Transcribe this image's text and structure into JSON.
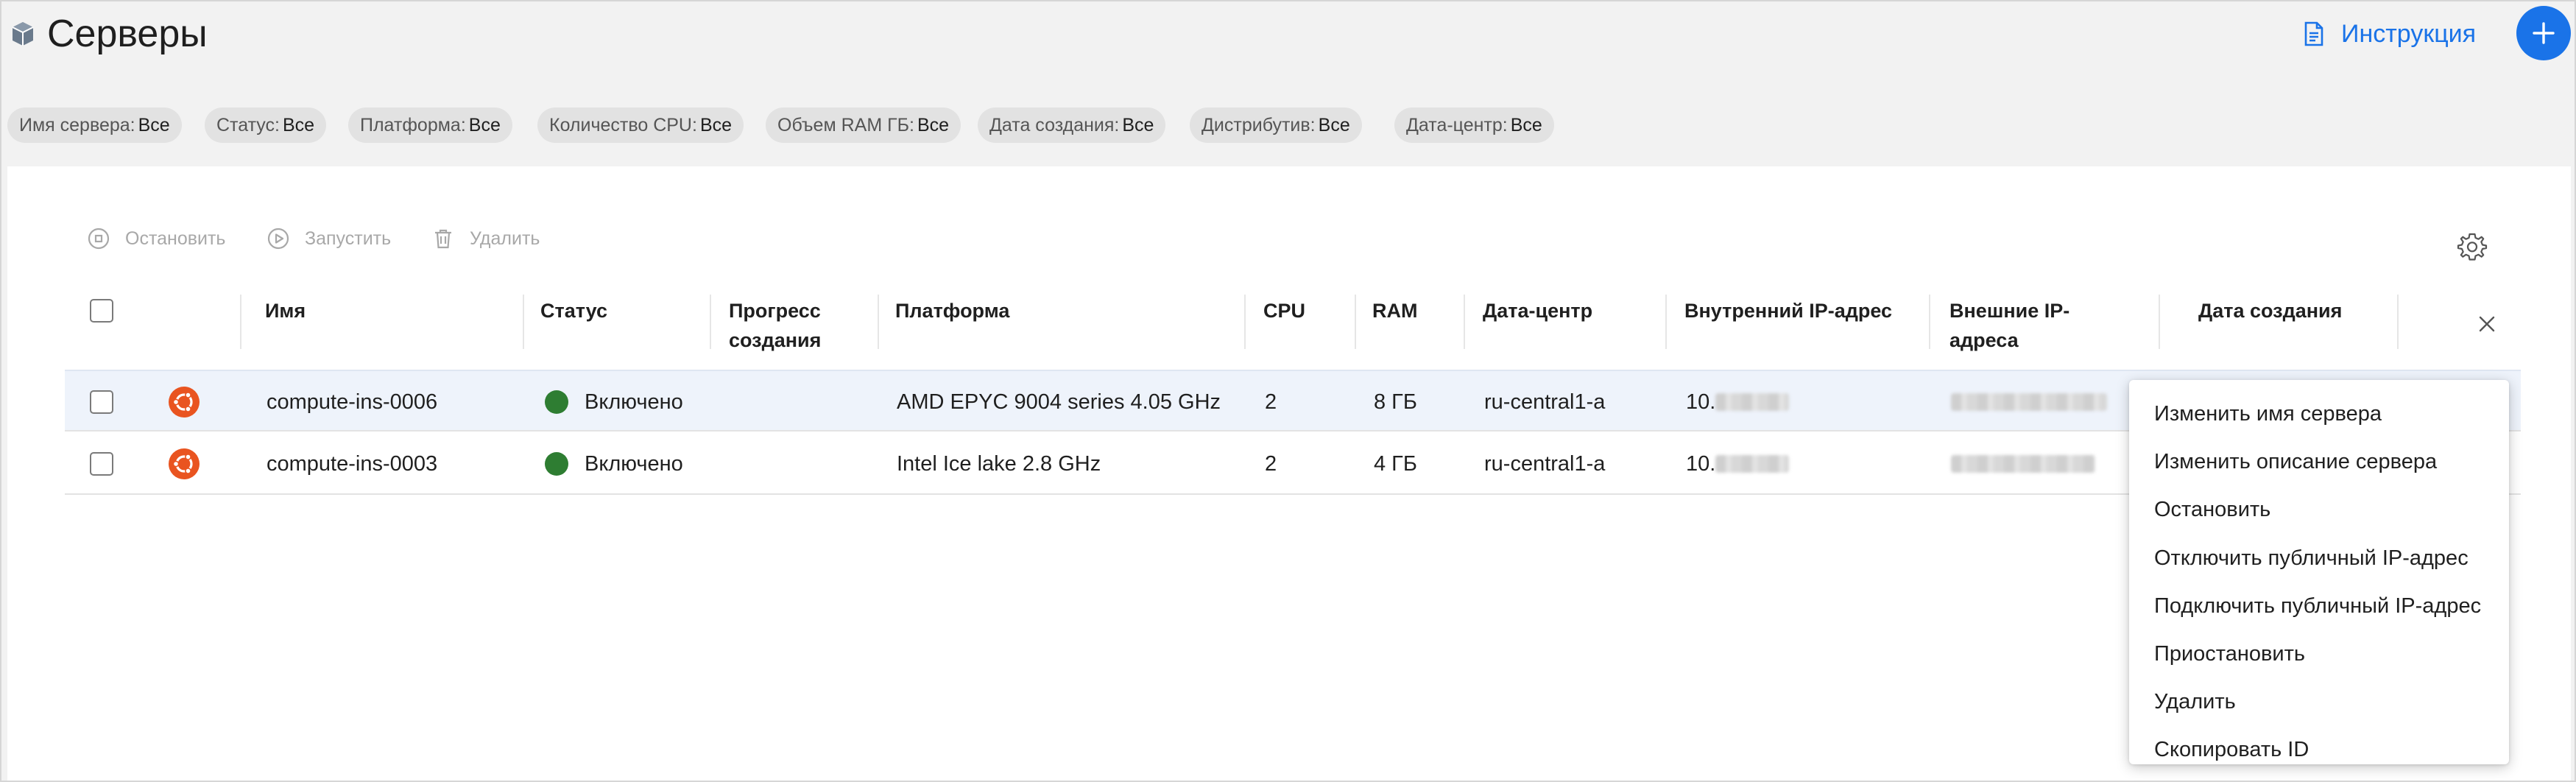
{
  "header": {
    "title": "Серверы",
    "title_icon": "cube-icon",
    "instruction_label": "Инструкция",
    "add_icon": "plus-icon",
    "accent_color": "#1a73e8"
  },
  "filters": [
    {
      "label": "Имя сервера:",
      "value": "Все"
    },
    {
      "label": "Статус:",
      "value": "Все"
    },
    {
      "label": "Платформа:",
      "value": "Все"
    },
    {
      "label": "Количество CPU:",
      "value": "Все"
    },
    {
      "label": "Объем RAM ГБ:",
      "value": "Все"
    },
    {
      "label": "Дата создания:",
      "value": "Все"
    },
    {
      "label": "Дистрибутив:",
      "value": "Все"
    },
    {
      "label": "Дата-центр:",
      "value": "Все"
    }
  ],
  "toolbar": {
    "stop_label": "Остановить",
    "start_label": "Запустить",
    "delete_label": "Удалить",
    "settings_icon": "gear-icon"
  },
  "table": {
    "columns": {
      "name": "Имя",
      "status": "Статус",
      "progress": "Прогресс создания",
      "platform": "Платформа",
      "cpu": "CPU",
      "ram": "RAM",
      "datacenter": "Дата-центр",
      "internal_ip": "Внутренний IP-адрес",
      "external_ip": "Внешние IP-адреса",
      "created": "Дата создания"
    },
    "rows": [
      {
        "name": "compute-ins-0006",
        "status": "Включено",
        "status_color": "#2e7d32",
        "platform": "AMD EPYC 9004 series 4.05 GHz",
        "cpu": "2",
        "ram": "8 ГБ",
        "datacenter": "ru-central1-a",
        "internal_ip": "10.",
        "os_icon": "ubuntu-icon"
      },
      {
        "name": "compute-ins-0003",
        "status": "Включено",
        "status_color": "#2e7d32",
        "platform": "Intel Ice lake 2.8 GHz",
        "cpu": "2",
        "ram": "4 ГБ",
        "datacenter": "ru-central1-a",
        "internal_ip": "10.",
        "os_icon": "ubuntu-icon"
      }
    ]
  },
  "context_menu": [
    "Изменить имя сервера",
    "Изменить описание сервера",
    "Остановить",
    "Отключить публичный IP-адрес",
    "Подключить публичный IP-адрес",
    "Приостановить",
    "Удалить",
    "Скопировать ID"
  ]
}
